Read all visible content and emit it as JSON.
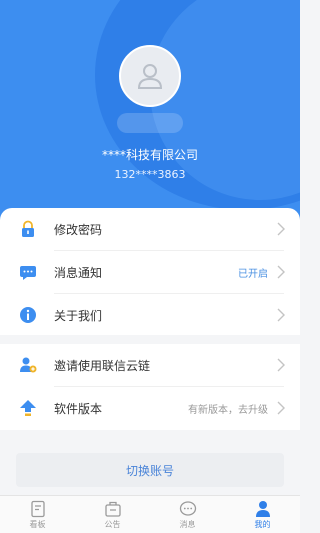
{
  "profile": {
    "company": "****科技有限公司",
    "phone": "132****3863"
  },
  "menu_group1": [
    {
      "label": "修改密码",
      "value": "",
      "icon": "lock-icon"
    },
    {
      "label": "消息通知",
      "value": "已开启",
      "icon": "message-icon"
    },
    {
      "label": "关于我们",
      "value": "",
      "icon": "info-icon"
    }
  ],
  "menu_group2": [
    {
      "label": "邀请使用联信云链",
      "value": "",
      "icon": "invite-user-icon"
    },
    {
      "label": "软件版本",
      "value": "有新版本，去升级",
      "icon": "upgrade-icon"
    }
  ],
  "switch_account": "切换账号",
  "tabs": [
    {
      "label": "看板",
      "icon": "dashboard-icon",
      "active": false
    },
    {
      "label": "公告",
      "icon": "announcement-icon",
      "active": false
    },
    {
      "label": "消息",
      "icon": "chat-icon",
      "active": false
    },
    {
      "label": "我的",
      "icon": "profile-icon",
      "active": true
    }
  ],
  "colors": {
    "primary": "#2f7fe8",
    "header_bg": "#3d8ef0",
    "value_blue": "#4a90e2",
    "value_gray": "#999999"
  }
}
